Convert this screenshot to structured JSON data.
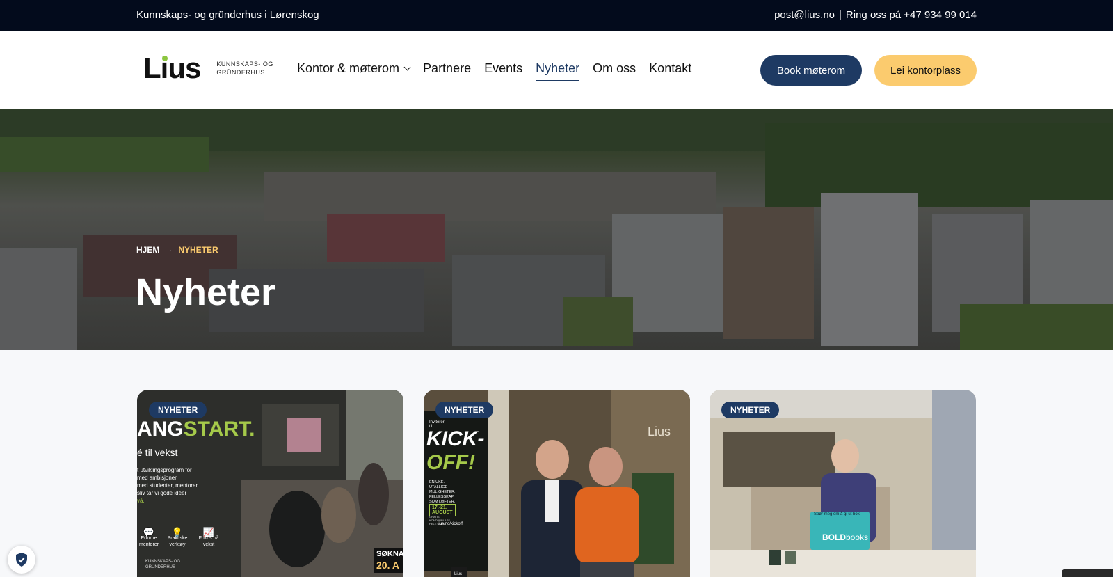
{
  "topbar": {
    "tagline": "Kunnskaps- og gründerhus i Lørenskog",
    "email": "post@lius.no",
    "separator": "|",
    "phone": "Ring oss på +47 934 99 014"
  },
  "logo": {
    "word": "Lius",
    "sub_line1": "KUNNSKAPS- OG",
    "sub_line2": "GRÜNDERHUS"
  },
  "nav": {
    "items": [
      {
        "label": "Kontor & møterom"
      },
      {
        "label": "Partnere"
      },
      {
        "label": "Events"
      },
      {
        "label": "Nyheter"
      },
      {
        "label": "Om oss"
      },
      {
        "label": "Kontakt"
      }
    ],
    "active": "Nyheter"
  },
  "buttons": {
    "book": "Book møterom",
    "lei": "Lei kontorplass"
  },
  "hero": {
    "breadcrumb_home": "HJEM",
    "breadcrumb_arrow": "→",
    "breadcrumb_current": "NYHETER",
    "title": "Nyheter"
  },
  "cards": [
    {
      "badge": "NYHETER",
      "art": {
        "headline_a": "ANG",
        "headline_b": "START.",
        "sub": "é til vekst",
        "lines": [
          "t utviklingsprogram for",
          "med ambisjoner.",
          "med studenter, mentorer",
          "sliv tar vi gode idéer",
          "vå."
        ],
        "icon1": "Erforne",
        "icon1b": "mentorer",
        "icon2": "Praktiske",
        "icon2b": "verktøy",
        "icon3": "Fokus på",
        "icon3b": "vekst",
        "soknad": "SØKNA",
        "date": "20. A",
        "footer1": "KUNNSKAPS- OG",
        "footer2": "GRÜNDERHUS"
      }
    },
    {
      "badge": "NYHETER",
      "art": {
        "invite": "Inviterer til",
        "kick": "KICK-",
        "off": "OFF!",
        "l1": "ÉN UKE.",
        "l2": "UTALLIGE MULIGHETER.",
        "l3": "FELLESSKAP SOM LØFTER.",
        "dates": "17.-21. AUGUST",
        "gratis": "GRATIS KONTORPLASS HELE UKEN",
        "url": "lius.no/kickoff",
        "wall": "Lius",
        "mug": "Lius"
      }
    },
    {
      "badge": "NYHETER",
      "art": {
        "sticker1": "Spør meg om å gi ut bok",
        "brand_a": "BOLD",
        "brand_b": "books"
      }
    }
  ],
  "colors": {
    "navy": "#1e3a63",
    "yellow": "#fbcb6e",
    "topbar": "#030b1c",
    "green": "#8cc63f"
  }
}
